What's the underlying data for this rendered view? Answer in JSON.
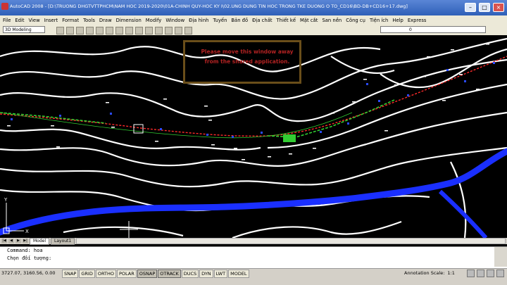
{
  "titlebar": {
    "title": "AutoCAD 2008 - [D:\\TRUONG DHGTVTTPHCM\\NAM HOC 2019-2020\\01A-CHINH QUY-HOC KY I\\02.UNG DUNG TIN HOC TRONG TKE DUONG O TO_CD16\\BD-DB+CD16+17.dwg]"
  },
  "menu": [
    "File",
    "Edit",
    "View",
    "Insert",
    "Format",
    "Tools",
    "Draw",
    "Dimension",
    "Modify",
    "Window",
    "Địa hình",
    "Tuyến",
    "Bản đồ",
    "Địa chất",
    "Thiết kế",
    "Mặt cắt",
    "San nền",
    "Công cụ",
    "Tiện ích",
    "Help",
    "Express"
  ],
  "toolbar": {
    "workspace": "3D Modeling",
    "layer_value": "0"
  },
  "overlay": {
    "line1": "Please move this window away",
    "line2": "from the shared application."
  },
  "tabs": {
    "model": "Model",
    "layout": "Layout1"
  },
  "command": {
    "line1": "Command: hoa",
    "line2": "Chọn đối tượng:"
  },
  "status": {
    "coords": "3727.07, 3160.56, 0.00",
    "buttons": [
      "SNAP",
      "GRID",
      "ORTHO",
      "POLAR",
      "OSNAP",
      "OTRACK",
      "DUCS",
      "DYN",
      "LWT",
      "MODEL"
    ],
    "annotation_label": "Annotation Scale:",
    "annotation_value": "1:1"
  },
  "colors": {
    "road_center": "#ff2a2a",
    "alignment": "#32cd32",
    "river": "#1a2fff",
    "contours": "#ffffff",
    "overlay_text": "#b22222"
  }
}
